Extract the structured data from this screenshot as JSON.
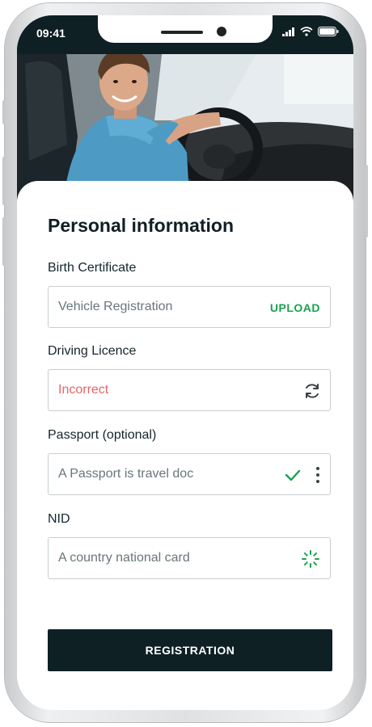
{
  "status_bar": {
    "time": "09:41"
  },
  "form": {
    "title": "Personal information",
    "fields": [
      {
        "label": "Birth Certificate",
        "value": "Vehicle Registration",
        "action": "UPLOAD",
        "state": "upload"
      },
      {
        "label": "Driving Licence",
        "value": "Incorrect",
        "state": "error",
        "icon": "refresh-icon"
      },
      {
        "label": "Passport (optional)",
        "value": "A Passport is travel doc",
        "state": "success",
        "icon": "checkmark-icon"
      },
      {
        "label": "NID",
        "value": "A country national card",
        "state": "loading",
        "icon": "loading-spinner-icon"
      }
    ],
    "submit_label": "REGISTRATION"
  },
  "colors": {
    "dark": "#0e2024",
    "accent_green": "#1aa24f",
    "error": "#e8646a",
    "field_border": "#c9ced0"
  }
}
